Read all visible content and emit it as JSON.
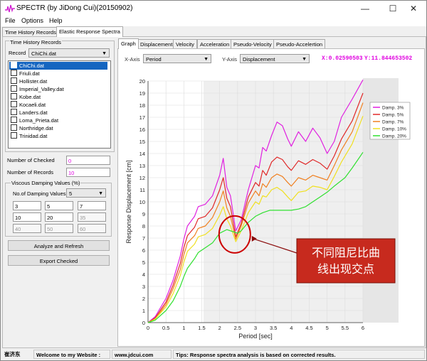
{
  "window": {
    "title": "SPECTR (by JiDong Cui)(20150902)",
    "controls": [
      "—",
      "☐",
      "✕"
    ]
  },
  "menu": [
    "File",
    "Options",
    "Help"
  ],
  "main_tabs": [
    "Time History Records",
    "Elastic Response Spectra"
  ],
  "left": {
    "group_title": "Time History Records",
    "record_label": "Record",
    "record_value": "ChiChi.dat",
    "records": [
      "ChiChi.dat",
      "Friuli.dat",
      "Hollister.dat",
      "Imperial_Valley.dat",
      "Kobe.dat",
      "Kocaeli.dat",
      "Landers.dat",
      "Loma_Prieta.dat",
      "Northridge.dat",
      "Trinidad.dat"
    ],
    "checked_label": "Number of Checked",
    "checked_value": "0",
    "records_label": "Number of Records",
    "records_value": "10",
    "damping_group": "Viscous Damping Values (%)",
    "damping_count_label": "No.of Damping Values",
    "damping_count_value": "5",
    "damping_values": [
      "3",
      "5",
      "7",
      "10",
      "20",
      "35",
      "40",
      "50",
      "60"
    ],
    "analyze_button": "Analyze and Refresh",
    "export_button": "Export Checked"
  },
  "right": {
    "tabs": [
      "Graph",
      "Displacement",
      "Velocity",
      "Acceleration",
      "Pseudo-Velocity",
      "Pseudo-Accelertion"
    ],
    "xaxis_label": "X-Axis",
    "xaxis_value": "Period",
    "yaxis_label": "Y-Axis",
    "yaxis_value": "Displacement",
    "coord_x": "X:0.02590503",
    "coord_y": "Y:11.844653502"
  },
  "annotation": {
    "line1": "不同阻尼比曲",
    "line2": "线出现交点"
  },
  "status": {
    "author": "崔济东",
    "welcome": "Welcome to my Website :",
    "website": "www.jdcui.com",
    "tips": "Tips: Response spectra analysis is based on corrected results."
  },
  "chart_data": {
    "type": "line",
    "xlabel": "Period [sec]",
    "ylabel": "Response Displacement [cm]",
    "xlim": [
      0,
      6
    ],
    "ylim": [
      0,
      20
    ],
    "xticks": [
      "0",
      "0.5",
      "1",
      "1.5",
      "2",
      "2.5",
      "3",
      "3.5",
      "4",
      "4.5",
      "5",
      "5.5",
      "6"
    ],
    "yticks": [
      "0",
      "1",
      "2",
      "3",
      "4",
      "5",
      "6",
      "7",
      "8",
      "9",
      "10",
      "11",
      "12",
      "13",
      "14",
      "15",
      "16",
      "17",
      "18",
      "19",
      "20"
    ],
    "grid": true,
    "legend_position": "right",
    "series": [
      {
        "name": "Damp. 3%",
        "color": "#e020e0",
        "x": [
          0,
          0.2,
          0.5,
          0.7,
          0.9,
          1.0,
          1.1,
          1.3,
          1.4,
          1.6,
          1.8,
          2.0,
          2.1,
          2.2,
          2.3,
          2.45,
          2.6,
          2.8,
          3.0,
          3.1,
          3.2,
          3.3,
          3.45,
          3.6,
          3.75,
          3.9,
          4.0,
          4.2,
          4.4,
          4.6,
          4.8,
          5.0,
          5.2,
          5.4,
          5.7,
          6.0
        ],
        "y": [
          0,
          0.5,
          2.0,
          3.5,
          5.5,
          6.9,
          8.0,
          8.8,
          9.6,
          9.8,
          10.5,
          12.2,
          13.6,
          11.2,
          10.5,
          7.6,
          8.5,
          11.0,
          13.0,
          12.8,
          14.5,
          14.2,
          15.5,
          16.6,
          16.3,
          15.2,
          14.6,
          15.8,
          15.0,
          16.1,
          15.3,
          14.0,
          15.0,
          17.0,
          18.5,
          20.1
        ]
      },
      {
        "name": "Damp. 5%",
        "color": "#e02828",
        "x": [
          0,
          0.2,
          0.5,
          0.7,
          0.9,
          1.0,
          1.1,
          1.3,
          1.4,
          1.6,
          1.8,
          2.0,
          2.1,
          2.2,
          2.3,
          2.45,
          2.6,
          2.8,
          3.0,
          3.1,
          3.2,
          3.3,
          3.45,
          3.6,
          3.75,
          3.9,
          4.0,
          4.2,
          4.4,
          4.6,
          4.8,
          5.0,
          5.2,
          5.4,
          5.7,
          6.0
        ],
        "y": [
          0,
          0.4,
          1.7,
          3.1,
          4.9,
          6.2,
          7.2,
          7.9,
          8.6,
          8.8,
          9.5,
          11.0,
          12.0,
          10.3,
          9.6,
          7.1,
          8.2,
          10.4,
          11.6,
          11.3,
          12.6,
          12.2,
          13.3,
          13.7,
          13.5,
          12.9,
          12.6,
          13.4,
          13.1,
          13.5,
          13.2,
          12.7,
          13.8,
          15.2,
          16.7,
          19.0
        ]
      },
      {
        "name": "Damp. 7%",
        "color": "#f08020",
        "x": [
          0,
          0.2,
          0.5,
          0.7,
          0.9,
          1.0,
          1.1,
          1.3,
          1.4,
          1.6,
          1.8,
          2.0,
          2.1,
          2.2,
          2.3,
          2.45,
          2.6,
          2.8,
          3.0,
          3.1,
          3.2,
          3.3,
          3.45,
          3.6,
          3.75,
          3.9,
          4.0,
          4.2,
          4.4,
          4.6,
          4.8,
          5.0,
          5.2,
          5.4,
          5.7,
          6.0
        ],
        "y": [
          0,
          0.3,
          1.5,
          2.8,
          4.4,
          5.6,
          6.6,
          7.2,
          7.8,
          8.0,
          8.7,
          10.0,
          10.9,
          9.5,
          8.8,
          6.9,
          8.0,
          9.9,
          10.9,
          10.5,
          11.5,
          11.2,
          12.0,
          12.3,
          12.1,
          11.6,
          11.3,
          12.0,
          11.8,
          12.2,
          12.0,
          11.8,
          13.0,
          14.3,
          15.8,
          18.2
        ]
      },
      {
        "name": "Damp. 10%",
        "color": "#f0e020",
        "x": [
          0,
          0.2,
          0.5,
          0.7,
          0.9,
          1.0,
          1.1,
          1.3,
          1.4,
          1.6,
          1.8,
          2.0,
          2.1,
          2.2,
          2.3,
          2.45,
          2.6,
          2.8,
          3.0,
          3.1,
          3.2,
          3.3,
          3.45,
          3.6,
          3.75,
          3.9,
          4.0,
          4.2,
          4.4,
          4.6,
          4.8,
          5.0,
          5.2,
          5.4,
          5.7,
          6.0
        ],
        "y": [
          0,
          0.3,
          1.3,
          2.4,
          3.9,
          5.0,
          5.9,
          6.5,
          7.1,
          7.3,
          7.8,
          8.9,
          9.6,
          8.6,
          8.0,
          6.7,
          7.6,
          9.1,
          10.0,
          9.8,
          10.5,
          10.4,
          11.0,
          11.2,
          10.9,
          10.4,
          10.1,
          10.8,
          10.9,
          11.3,
          11.2,
          11.0,
          12.1,
          13.3,
          14.8,
          17.1
        ]
      },
      {
        "name": "Damp. 20%",
        "color": "#30e030",
        "x": [
          0,
          0.2,
          0.5,
          0.7,
          0.9,
          1.0,
          1.1,
          1.3,
          1.4,
          1.6,
          1.8,
          2.0,
          2.2,
          2.4,
          2.5,
          2.6,
          2.8,
          3.0,
          3.2,
          3.4,
          3.6,
          3.8,
          4.0,
          4.2,
          4.4,
          4.6,
          4.8,
          5.0,
          5.2,
          5.5,
          5.7,
          6.0
        ],
        "y": [
          0,
          0.2,
          1.0,
          1.8,
          3.0,
          3.8,
          4.5,
          5.3,
          5.8,
          6.2,
          6.6,
          7.4,
          7.7,
          7.5,
          7.4,
          7.6,
          8.3,
          8.8,
          9.1,
          9.3,
          9.3,
          9.3,
          9.3,
          9.4,
          9.6,
          10.0,
          10.4,
          10.8,
          11.3,
          12.0,
          12.8,
          14.1
        ]
      }
    ]
  },
  "colors": {
    "selection": "#1565c0",
    "annotation_border": "#cc0000",
    "annotation_bg": "#c72a1e",
    "coord_text": "#e000e0"
  }
}
